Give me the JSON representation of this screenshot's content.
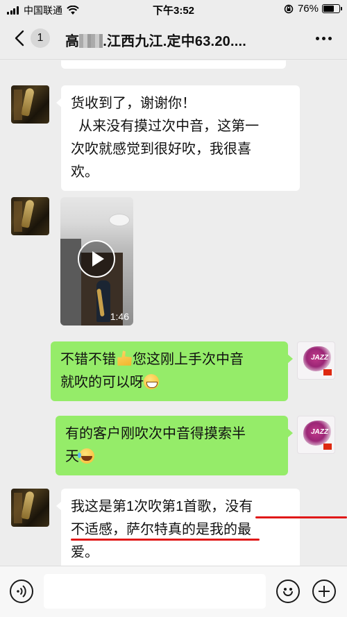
{
  "status_bar": {
    "carrier": "中国联通",
    "time": "下午3:52",
    "battery": "76%",
    "battery_level": 0.76,
    "icons": [
      "signal-icon",
      "wifi-icon",
      "rotation-lock-icon",
      "battery-icon"
    ]
  },
  "nav": {
    "back_icon": "chevron-left-icon",
    "unread_count": "1",
    "title_prefix": "高",
    "title_suffix": ".江西九江.定中63.20....",
    "more_icon": "more-dots-icon"
  },
  "messages": [
    {
      "side": "left",
      "type": "text",
      "lines": [
        "货收到了，谢谢你！",
        "  从来没有摸过次中音，这第一",
        "次吹就感觉到很好吹，我很喜",
        "欢。"
      ]
    },
    {
      "side": "left",
      "type": "video",
      "duration": "1:46",
      "icon": "play-icon"
    },
    {
      "side": "right",
      "type": "text",
      "line1_a": "不错不错",
      "line1_emoji": "thumbs-up-icon",
      "line1_b": "您这刚上手次中音",
      "line2": "就吹的可以呀",
      "line2_emoji": "grin-icon"
    },
    {
      "side": "right",
      "type": "text",
      "line1": "有的客户刚吹次中音得摸索半",
      "line2": "天",
      "line2_emoji": "laugh-tears-icon"
    },
    {
      "side": "left",
      "type": "text",
      "lines": [
        "我这是第1次吹第1首歌，没有",
        "不适感，萨尔特真的是我的最",
        "爱。"
      ],
      "underline_color": "#e01818"
    }
  ],
  "input_bar": {
    "voice_icon": "voice-icon",
    "input_value": "",
    "emoji_icon": "emoji-icon",
    "plus_icon": "plus-icon"
  },
  "colors": {
    "background": "#ededed",
    "bubble_self": "#95ec69",
    "bubble_other": "#ffffff",
    "highlight_underline": "#e01818"
  }
}
